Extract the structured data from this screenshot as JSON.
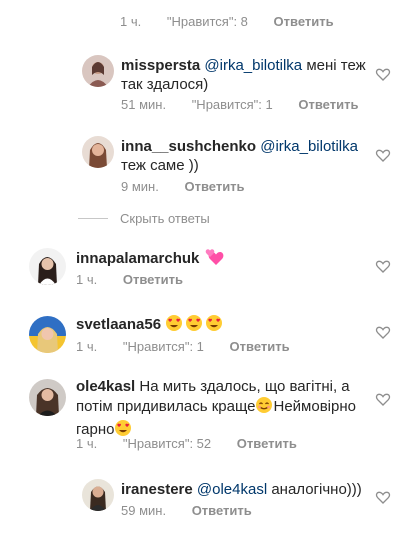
{
  "top_meta": {
    "time": "1 ч.",
    "likes": "\"Нравится\": 8",
    "reply": "Ответить"
  },
  "comments": [
    {
      "username": "misspersta",
      "mention": "@irka_bilotilka",
      "text": " мені теж так здалося)",
      "time": "51 мин.",
      "likes": "\"Нравится\": 1",
      "reply": "Ответить"
    },
    {
      "username": "inna__sushchenko",
      "mention": "@irka_bilotilka",
      "text": " теж саме ))",
      "time": "9 мин.",
      "reply": "Ответить"
    },
    {
      "username": "innapalamarchuk",
      "text": "",
      "emoji": "two-hearts",
      "time": "1 ч.",
      "reply": "Ответить"
    },
    {
      "username": "svetlaana56",
      "emoji": "heart-eyes x3",
      "time": "1 ч.",
      "likes": "\"Нравится\": 1",
      "reply": "Ответить"
    },
    {
      "username": "ole4kasl",
      "text_part1": " На мить здалось, що вагітні, а потім придивилась краще",
      "text_part2": "Неймовірно гарно",
      "time": "1 ч.",
      "likes": "\"Нравится\": 52",
      "reply": "Ответить"
    },
    {
      "username": "iranestere",
      "mention": "@ole4kasl",
      "text": " аналогічно)))",
      "time": "59 мин.",
      "reply": "Ответить"
    }
  ],
  "hide_replies": "Скрыть ответы",
  "colors": {
    "text": "#262626",
    "meta": "#8e8e8e",
    "mention": "#00376b",
    "heart_outline": "#8e8e8e"
  }
}
